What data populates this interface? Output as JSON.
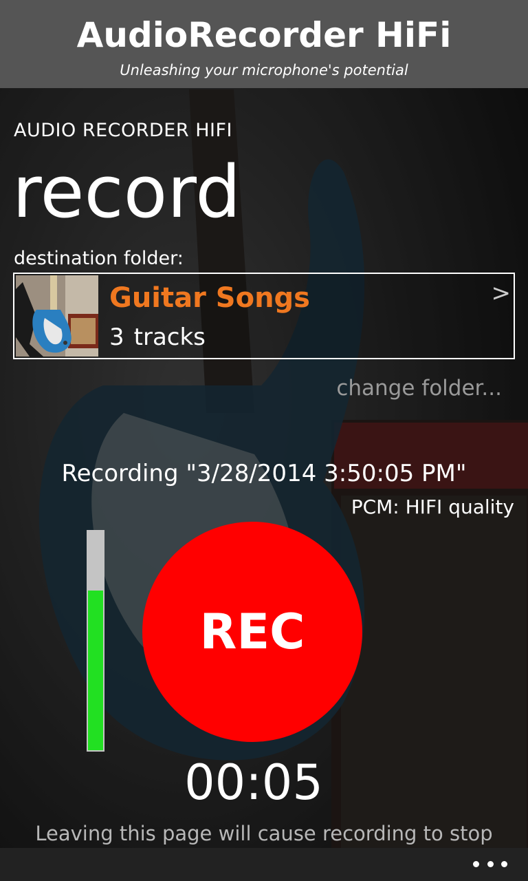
{
  "header": {
    "app_title": "AudioRecorder HiFi",
    "tagline": "Unleashing your microphone's potential"
  },
  "page": {
    "section_label": "AUDIO RECORDER HIFI",
    "title": "record"
  },
  "destination": {
    "label": "destination folder:",
    "folder_name": "Guitar Songs",
    "track_count": "3",
    "track_unit": "tracks",
    "chevron": ">",
    "change_folder": "change folder..."
  },
  "recording": {
    "name": "Recording \"3/28/2014 3:50:05 PM\"",
    "quality": "PCM: HIFI quality",
    "rec_label": "REC",
    "timer": "00:05",
    "level_fraction": 0.73,
    "warning": "Leaving this page will cause recording to stop"
  },
  "appbar": {
    "more_icon": "ellipsis-icon"
  },
  "colors": {
    "title_bar": "#555555",
    "folder_name": "#f07820",
    "rec_button": "#ff0000",
    "level_fill": "#22e022",
    "level_track": "#c4c4c4"
  }
}
